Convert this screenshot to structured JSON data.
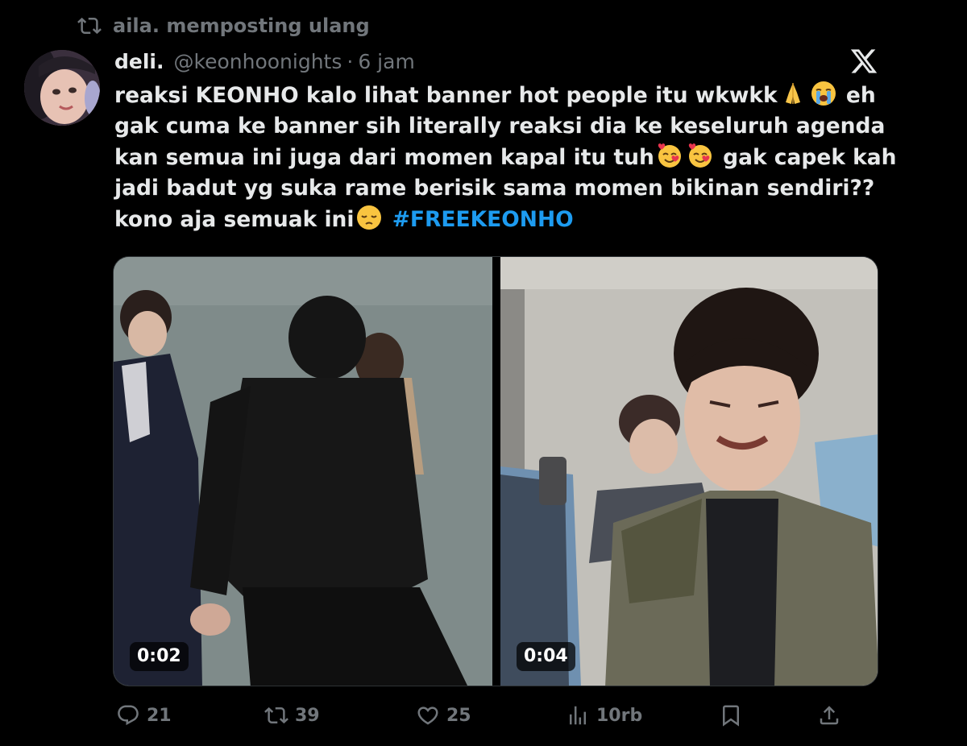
{
  "repost_banner": {
    "text": "aila. memposting ulang",
    "icon": "repost-icon"
  },
  "tweet": {
    "author": {
      "display_name": "deli.",
      "handle": "@keonhoonights",
      "avatar": "avatar-image"
    },
    "separator": "·",
    "time": "6 jam",
    "platform_icon": "x-logo-icon",
    "text_lines": [
      [
        "reaksi KEONHO kalo lihat banner hot people itu wkwkk",
        "folded-hands-emoji",
        "loudly-crying-emoji",
        " eh"
      ],
      [
        "gak cuma ke banner sih literally reaksi dia ke keseluruh agenda"
      ],
      [
        "kan semua ini juga dari momen kapal itu tuh",
        "smiling-face-with-hearts-emoji",
        "smiling-face-with-hearts-emoji",
        " gak capek kah"
      ],
      [
        "jadi badut yg suka rame berisik sama momen bikinan sendiri??"
      ],
      [
        "kono aja semuak ini",
        "pensive-face-emoji",
        " "
      ]
    ],
    "line1": "reaksi KEONHO kalo lihat banner hot people itu wkwkk",
    "line1_end": "eh",
    "line2": "gak cuma ke banner sih literally reaksi dia ke keseluruh agenda",
    "line3": "kan semua ini juga dari momen kapal itu tuh",
    "line3_end": "gak capek kah",
    "line4": "jadi badut yg suka rame berisik sama momen bikinan sendiri??",
    "line5": "kono aja semuak ini",
    "hashtag": "#FREEKEONHO",
    "hashtag_color": "#1d9bf0",
    "media": [
      {
        "type": "video",
        "duration": "0:02"
      },
      {
        "type": "video",
        "duration": "0:04"
      }
    ],
    "actions": {
      "replies": "21",
      "reposts": "39",
      "likes": "25",
      "views": "10rb"
    }
  },
  "colors": {
    "background": "#000000",
    "text_primary": "#e7e9ea",
    "text_secondary": "#71767b",
    "accent": "#1d9bf0"
  }
}
